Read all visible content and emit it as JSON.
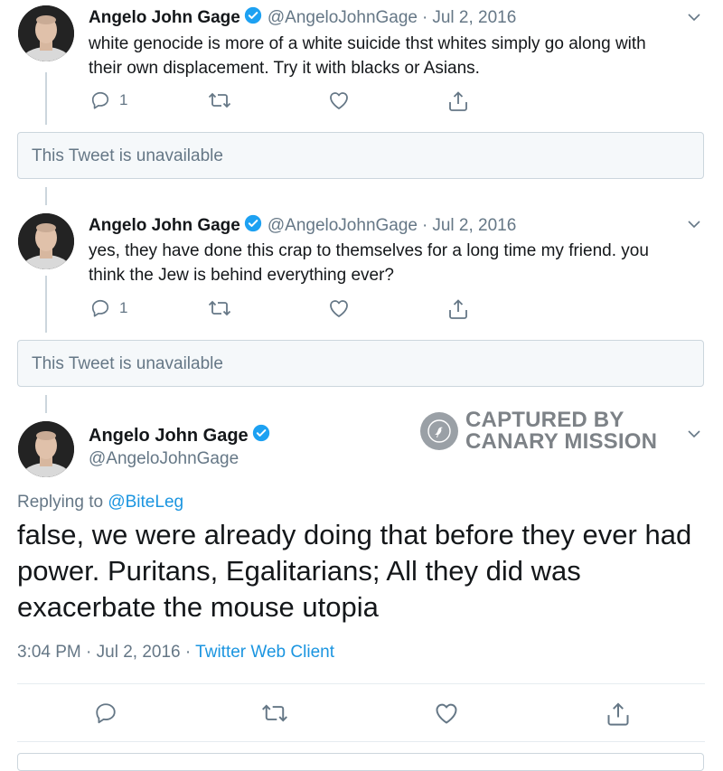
{
  "tweets": [
    {
      "name": "Angelo John Gage",
      "handle": "@AngeloJohnGage",
      "separator": "·",
      "date": "Jul 2, 2016",
      "text_line1": "white genocide is more of a white suicide thst whites simply go along with",
      "text_line2": "their own displacement. Try it with blacks or Asians.",
      "reply_count": "1"
    },
    {
      "name": "Angelo John Gage",
      "handle": "@AngeloJohnGage",
      "separator": "·",
      "date": "Jul 2, 2016",
      "text_line1": "yes, they have done this crap to themselves for a long time my friend. you",
      "text_line2": "think the Jew is behind everything ever?",
      "reply_count": "1"
    }
  ],
  "unavailable_notice": "This Tweet is unavailable",
  "focused_tweet": {
    "name": "Angelo John Gage",
    "handle": "@AngeloJohnGage",
    "replying_prefix": "Replying to",
    "replying_to": "@BiteLeg",
    "text_line1": "false, we were already doing that before they ever had",
    "text_line2": "power. Puritans, Egalitarians; All they did was",
    "text_line3": "exacerbate the mouse utopia",
    "time": "3:04 PM",
    "separator": "·",
    "date": "Jul 2, 2016",
    "client": "Twitter Web Client"
  },
  "watermark": {
    "line1": "CAPTURED BY",
    "line2": "CANARY MISSION"
  },
  "colors": {
    "verified": "#1da1f2",
    "link": "#1b95e0",
    "secondary_text": "#657786",
    "border": "#ccd6dd"
  },
  "icons": [
    "reply-icon",
    "retweet-icon",
    "like-icon",
    "share-icon",
    "chevron-down-icon",
    "verified-badge-icon"
  ]
}
